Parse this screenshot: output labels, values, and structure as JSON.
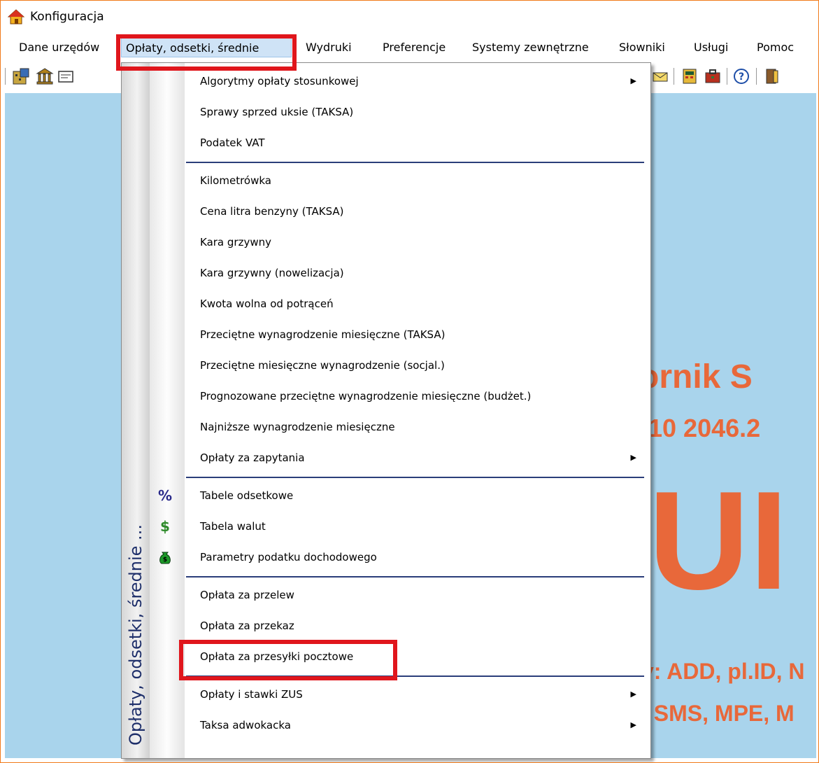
{
  "window": {
    "title": "Konfiguracja"
  },
  "menubar": {
    "items": [
      {
        "label": "Dane urzędów"
      },
      {
        "label": "Opłaty, odsetki, średnie"
      },
      {
        "label": "Wydruki"
      },
      {
        "label": "Preferencje"
      },
      {
        "label": "Systemy zewnętrzne"
      },
      {
        "label": "Słowniki"
      },
      {
        "label": "Usługi"
      },
      {
        "label": "Pomoc"
      }
    ]
  },
  "dropdown": {
    "side_label": "Opłaty, odsetki, średnie ...",
    "items": [
      {
        "label": "Algorytmy opłaty stosunkowej",
        "submenu": "▶"
      },
      {
        "label": "Sprawy sprzed uksie (TAKSA)"
      },
      {
        "label": "Podatek VAT"
      },
      {
        "label": "Kilometrówka"
      },
      {
        "label": "Cena litra benzyny (TAKSA)"
      },
      {
        "label": "Kara grzywny"
      },
      {
        "label": "Kara grzywny (nowelizacja)"
      },
      {
        "label": "Kwota wolna od potrąceń"
      },
      {
        "label": "Przeciętne wynagrodzenie miesięczne (TAKSA)"
      },
      {
        "label": "Przeciętne miesięczne wynagrodzenie (socjal.)"
      },
      {
        "label": "Prognozowane przeciętne wynagrodzenie miesięczne (budżet.)"
      },
      {
        "label": "Najniższe wynagrodzenie miesięczne"
      },
      {
        "label": "Opłaty za zapytania",
        "submenu": "▶"
      },
      {
        "label": "Tabele odsetkowe",
        "icon": "%"
      },
      {
        "label": "Tabela walut",
        "icon": "$"
      },
      {
        "label": "Parametry podatku dochodowego",
        "icon": "money-bag"
      },
      {
        "label": "Opłata za przelew"
      },
      {
        "label": "Opłata za przekaz"
      },
      {
        "label": "Opłata za przesyłki pocztowe"
      },
      {
        "label": "Opłaty i stawki ZUS",
        "submenu": "▶"
      },
      {
        "label": "Taksa adwokacka",
        "submenu": "▶"
      }
    ]
  },
  "background": {
    "line1": "ornik S",
    "line2": ".10 2046.2",
    "line3": "UI",
    "line4": "y: ADD, pl.ID, N",
    "line5": ", SMS, MPE, M"
  },
  "colors": {
    "highlight": "#e0161c",
    "desktop": "#a9d4ec",
    "brand_text": "#e8683a",
    "menu_active": "#cfe3f6"
  }
}
